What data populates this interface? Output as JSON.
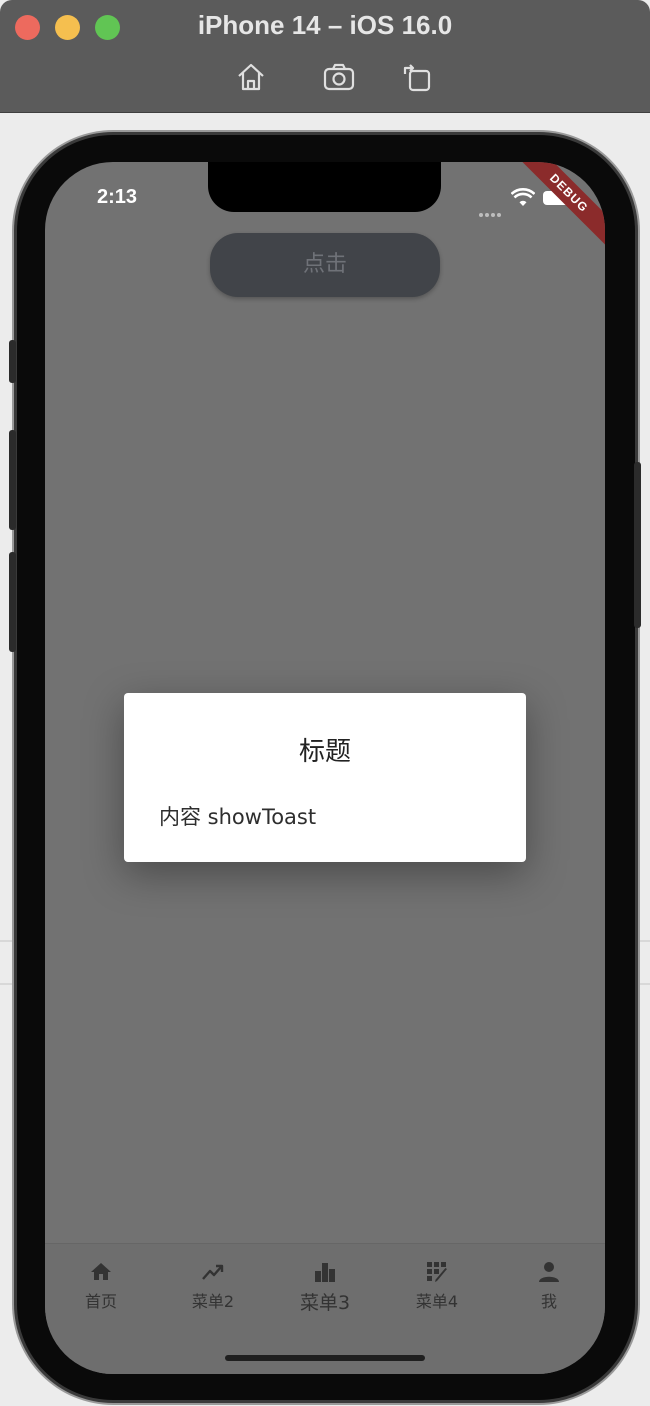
{
  "window": {
    "title": "iPhone 14 – iOS 16.0",
    "toolbar_icons": [
      "home-icon",
      "screenshot-icon",
      "rotate-icon"
    ]
  },
  "status_bar": {
    "time": "2:13",
    "debug_label": "DEBUG"
  },
  "main": {
    "click_button_label": "点击"
  },
  "dialog": {
    "title": "标题",
    "content": "内容 showToast"
  },
  "tabbar": {
    "items": [
      {
        "label": "首页",
        "icon": "home-icon"
      },
      {
        "label": "菜单2",
        "icon": "trending-icon"
      },
      {
        "label": "菜单3",
        "icon": "bar-chart-icon"
      },
      {
        "label": "菜单4",
        "icon": "grid-edit-icon"
      },
      {
        "label": "我",
        "icon": "person-icon"
      }
    ]
  },
  "colors": {
    "screen_overlay": "#727272",
    "titlebar": "#5b5b5b",
    "dialog_bg": "#ffffff",
    "debug_ribbon": "#8b2b2b"
  }
}
